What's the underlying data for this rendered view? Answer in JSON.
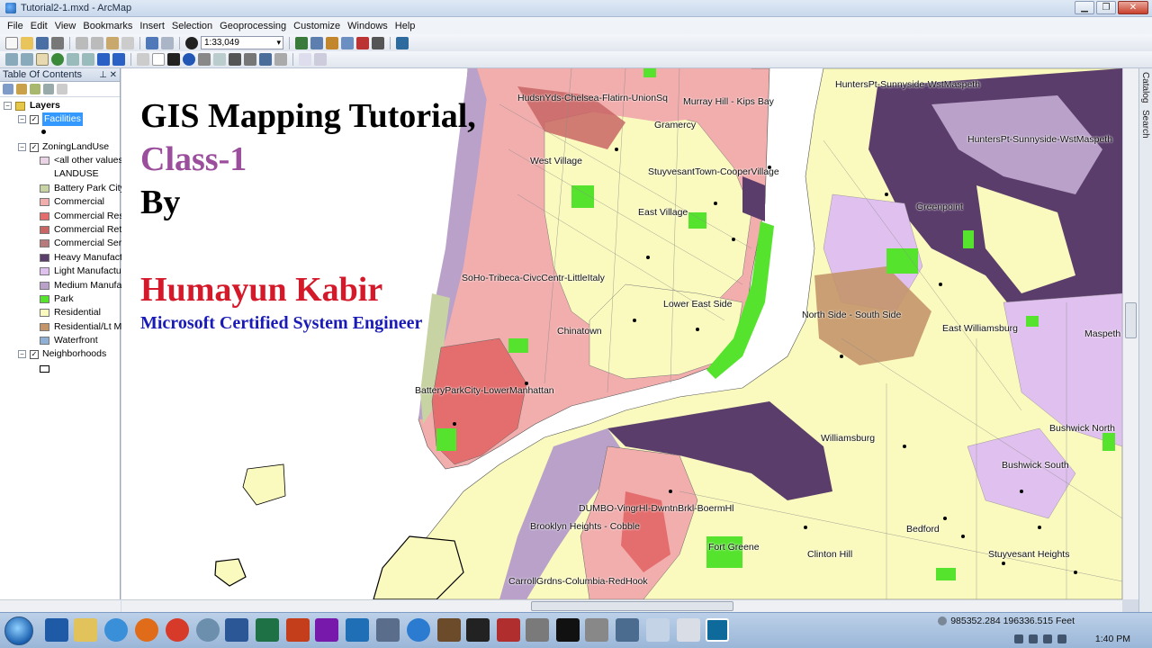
{
  "window": {
    "title": "Tutorial2-1.mxd - ArcMap"
  },
  "menu": [
    "File",
    "Edit",
    "View",
    "Bookmarks",
    "Insert",
    "Selection",
    "Geoprocessing",
    "Customize",
    "Windows",
    "Help"
  ],
  "toolbar": {
    "scale": "1:33,049"
  },
  "toc": {
    "title": "Table Of Contents",
    "pins": "⊥ ✕",
    "layers_label": "Layers",
    "facilities_label": "Facilities",
    "zoning_label": "ZoningLandUse",
    "zoning_items": [
      {
        "label": "<all other values",
        "color": "#ebd3e6"
      },
      {
        "label": "LANDUSE",
        "color": ""
      },
      {
        "label": "Battery Park City",
        "color": "#c8d3a4"
      },
      {
        "label": "Commercial",
        "color": "#f2adad"
      },
      {
        "label": "Commercial Res",
        "color": "#e46e6e"
      },
      {
        "label": "Commercial Ret",
        "color": "#c96565"
      },
      {
        "label": "Commercial Ser",
        "color": "#b87b7b"
      },
      {
        "label": "Heavy Manufact",
        "color": "#5a3d6b"
      },
      {
        "label": "Light Manufactu",
        "color": "#e0c0ee"
      },
      {
        "label": "Medium Manufa",
        "color": "#b9a1c9"
      },
      {
        "label": "Park",
        "color": "#55e32e"
      },
      {
        "label": "Residential",
        "color": "#fafabe"
      },
      {
        "label": "Residential/Lt M",
        "color": "#c4956a"
      },
      {
        "label": "Waterfront",
        "color": "#8fb0d4"
      }
    ],
    "neighborhoods_label": "Neighborhoods"
  },
  "overlay": {
    "line1": "GIS Mapping Tutorial,",
    "line2": "Class-1",
    "line3": "By",
    "author": "Humayun Kabir",
    "credential": "Microsoft Certified System Engineer"
  },
  "neighborhoods": [
    "HudsnYds-Chelsea-Flatirn-UnionSq",
    "Murray Hill - Kips Bay",
    "Gramercy",
    "West Village",
    "StuyvesantTown-CooperVillage",
    "East Village",
    "SoHo-Tribeca-CivcCentr-LittleItaly",
    "Lower East Side",
    "Chinatown",
    "BatteryParkCity-LowerManhattan",
    "HuntersPt-Sunnyside-WstMaspeth",
    "HuntersPt-Sunnyside-WstMaspeth",
    "Greenpoint",
    "North Side - South Side",
    "East Williamsburg",
    "Maspeth",
    "Williamsburg",
    "Bushwick North",
    "Bushwick South",
    "DUMBO-VingrHl-DwntnBrkl-BoermHl",
    "Brooklyn Heights - Cobble",
    "Fort Greene",
    "Clinton Hill",
    "Bedford",
    "Stuyvesant Heights",
    "CarrollGrdns-Columbia-RedHook"
  ],
  "right_dock": [
    "Catalog",
    "Search"
  ],
  "status": {
    "coordinates": "985352.284  196336.515 Feet"
  },
  "clock": "1:40 PM"
}
